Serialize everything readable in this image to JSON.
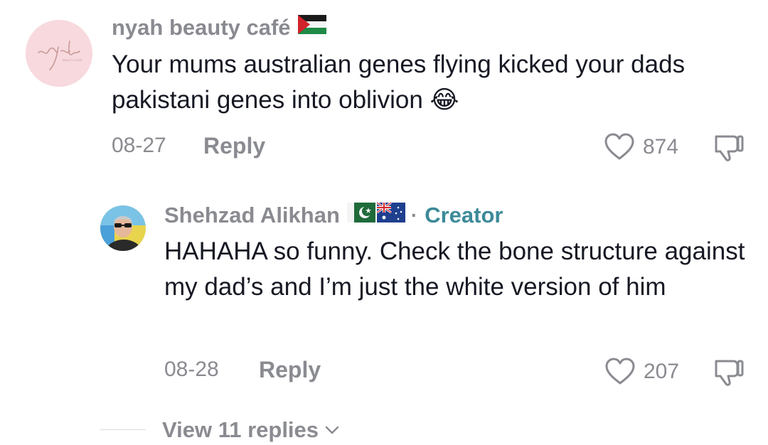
{
  "comments": [
    {
      "username": "nyah beauty café",
      "avatar_text": "nyah",
      "avatar_subtext": "BEAUTY CAFE",
      "flag_icon": "palestine-flag-icon",
      "text": "Your mums australian genes flying kicked your dads pakistani genes into oblivion",
      "emoji": "😂",
      "date": "08-27",
      "reply_label": "Reply",
      "likes": "874"
    }
  ],
  "reply": {
    "username": "Shehzad Alikhan",
    "flag_icons": [
      "pakistan-flag-icon",
      "australia-flag-icon"
    ],
    "separator": "·",
    "creator_label": "Creator",
    "text": "HAHAHA so funny. Check the bone structure against my dad’s and I’m just the white version of him",
    "date": "08-28",
    "reply_label": "Reply",
    "likes": "207"
  },
  "view_replies_label": "View 11 replies",
  "colors": {
    "text": "#161823",
    "muted": "#8a8b91",
    "creator": "#3c8a99",
    "avatar_bg": "#f7d9de"
  }
}
